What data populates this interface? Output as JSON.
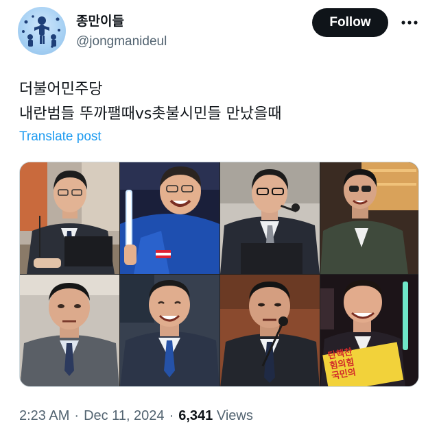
{
  "author": {
    "display_name": "종만이들",
    "handle": "@jongmanideul"
  },
  "actions": {
    "follow_label": "Follow",
    "more_icon": "more-horizontal-icon"
  },
  "post": {
    "lines": [
      "더불어민주당",
      "내란범들 뚜까팰때vs촛불시민들 만났을때"
    ],
    "translate_label": "Translate post"
  },
  "media": {
    "photo_count": 8,
    "sign_text": [
      "탄핵찬",
      "힘의힘",
      "국민의"
    ]
  },
  "meta": {
    "time": "2:23 AM",
    "date": "Dec 11, 2024",
    "separator": "·",
    "views_count": "6,341",
    "views_label": "Views"
  },
  "colors": {
    "text": "#0f1419",
    "secondary": "#536471",
    "link": "#1d9bf0",
    "follow_bg": "#0f1419"
  }
}
